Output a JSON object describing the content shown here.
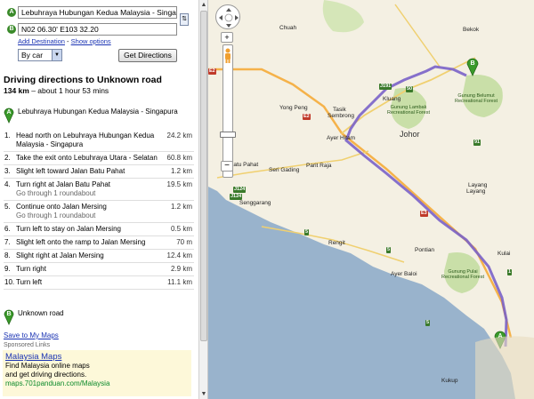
{
  "form": {
    "origin_value": "Lebuhraya Hubungan Kedua Malaysia - Singapura",
    "destination_value": "N02 06.30' E103 32.20",
    "origin_marker": "A",
    "destination_marker": "B",
    "add_destination_label": "Add Destination",
    "separator": "-",
    "show_options_label": "Show options",
    "mode_selected": "By car",
    "get_directions_label": "Get Directions"
  },
  "directions": {
    "title": "Driving directions to Unknown road",
    "distance": "134 km",
    "duration_text": "– about 1 hour 53 mins",
    "start_label": "Lebuhraya Hubungan Kedua Malaysia - Singapura",
    "end_label": "Unknown road",
    "steps": [
      {
        "num": "1.",
        "text": "Head north on Lebuhraya Hubungan Kedua Malaysia - Singapura",
        "dist": "24.2 km"
      },
      {
        "num": "2.",
        "text": "Take the exit onto Lebuhraya Utara - Selatan",
        "dist": "60.8 km"
      },
      {
        "num": "3.",
        "text": "Slight left toward Jalan Batu Pahat",
        "dist": "1.2 km"
      },
      {
        "num": "4.",
        "text": "Turn right at Jalan Batu Pahat",
        "sub": "Go through 1 roundabout",
        "dist": "19.5 km"
      },
      {
        "num": "5.",
        "text": "Continue onto Jalan Mersing",
        "sub": "Go through 1 roundabout",
        "dist": "1.2 km"
      },
      {
        "num": "6.",
        "text": "Turn left to stay on Jalan Mersing",
        "dist": "0.5 km"
      },
      {
        "num": "7.",
        "text": "Slight left onto the ramp to Jalan Mersing",
        "dist": "70 m"
      },
      {
        "num": "8.",
        "text": "Slight right at Jalan Mersing",
        "dist": "12.4 km"
      },
      {
        "num": "9.",
        "text": "Turn right",
        "dist": "2.9 km"
      },
      {
        "num": "10.",
        "text": "Turn left",
        "dist": "11.1 km"
      }
    ],
    "save_link": "Save to My Maps"
  },
  "ads": {
    "sponsored_label": "Sponsored Links",
    "title": "Malaysia Maps",
    "line1": "Find Malaysia online maps",
    "line2": "and get driving directions.",
    "url": "maps.701panduan.com/Malaysia"
  },
  "map": {
    "labels": {
      "chuah": "Chuah",
      "bekok": "Bekok",
      "kluang": "Kluang",
      "yong_peng": "Yong Peng",
      "tasik": "Tasik",
      "sembrong": "Sembrong",
      "ayer_hitam": "Ayer Hitam",
      "johor": "Johor",
      "batu_pahat": "Batu Pahat",
      "seri_gading": "Seri Gading",
      "parit_raja": "Parit Raja",
      "senggarang": "Senggarang",
      "rengit": "Rengit",
      "ayer_baloi": "Ayer Baloi",
      "pontian": "Pontian",
      "kulai": "Kulai",
      "layang": "Layang",
      "layang2": "Layang",
      "kukup": "Kukup",
      "forest1": "Gunung Belumut Recreational Forest",
      "forest2": "Gunung Lambak Recreational Forest",
      "forest3": "Gunung Pulai Recreational Forest",
      "marker_a": "A",
      "marker_b": "B"
    },
    "shields": [
      "E2",
      "J191",
      "E2",
      "50",
      "J124",
      "5",
      "91",
      "E3",
      "5",
      "1",
      "5",
      "J124"
    ],
    "colors": {
      "route": "#7a62c8",
      "land": "#f4f0e3",
      "water": "#99b3cc",
      "forest": "#c9dfa8",
      "highway": "#f5b24a"
    }
  }
}
